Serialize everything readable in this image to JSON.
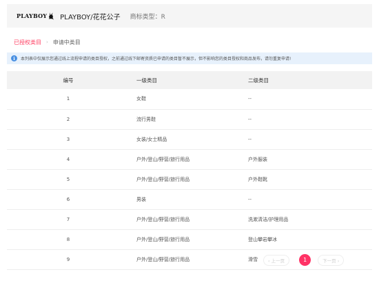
{
  "header": {
    "logo_text": "PLAYBOY",
    "logo_icon": "bunny-icon",
    "brand_name": "PLAYBOY/花花公子",
    "type_label": "商标类型：R"
  },
  "tabs": [
    {
      "label": "已授权类目",
      "active": true
    },
    {
      "label": "申请中类目",
      "active": false
    }
  ],
  "notice": {
    "icon": "info-icon",
    "text": "本列表中仅展示您通过线上流程申请的类目授权，之前通过线下邮寄资质已申请的类目暂不展示，但不影响您的类目授权和商品发布，请勿重复申请!"
  },
  "table": {
    "headers": [
      "编号",
      "一级类目",
      "二级类目"
    ],
    "rows": [
      [
        "1",
        "女鞋",
        "--"
      ],
      [
        "2",
        "流行男鞋",
        "--"
      ],
      [
        "3",
        "女装/女士精品",
        "--"
      ],
      [
        "4",
        "户外/登山/野营/旅行用品",
        "户外服装"
      ],
      [
        "5",
        "户外/登山/野营/旅行用品",
        "户外鞋靴"
      ],
      [
        "6",
        "男装",
        "--"
      ],
      [
        "7",
        "户外/登山/野营/旅行用品",
        "洗漱清洁/护理用品"
      ],
      [
        "8",
        "户外/登山/野营/旅行用品",
        "登山攀岩攀冰"
      ],
      [
        "9",
        "户外/登山/野营/旅行用品",
        "滑雪"
      ]
    ]
  },
  "pagination": {
    "prev_label": "‹ 上一页",
    "current_page": "1",
    "next_label": "下一页 ›"
  },
  "colors": {
    "accent": "#ff3366",
    "notice_bg": "#e7f1fc",
    "info_blue": "#4a90e2"
  }
}
